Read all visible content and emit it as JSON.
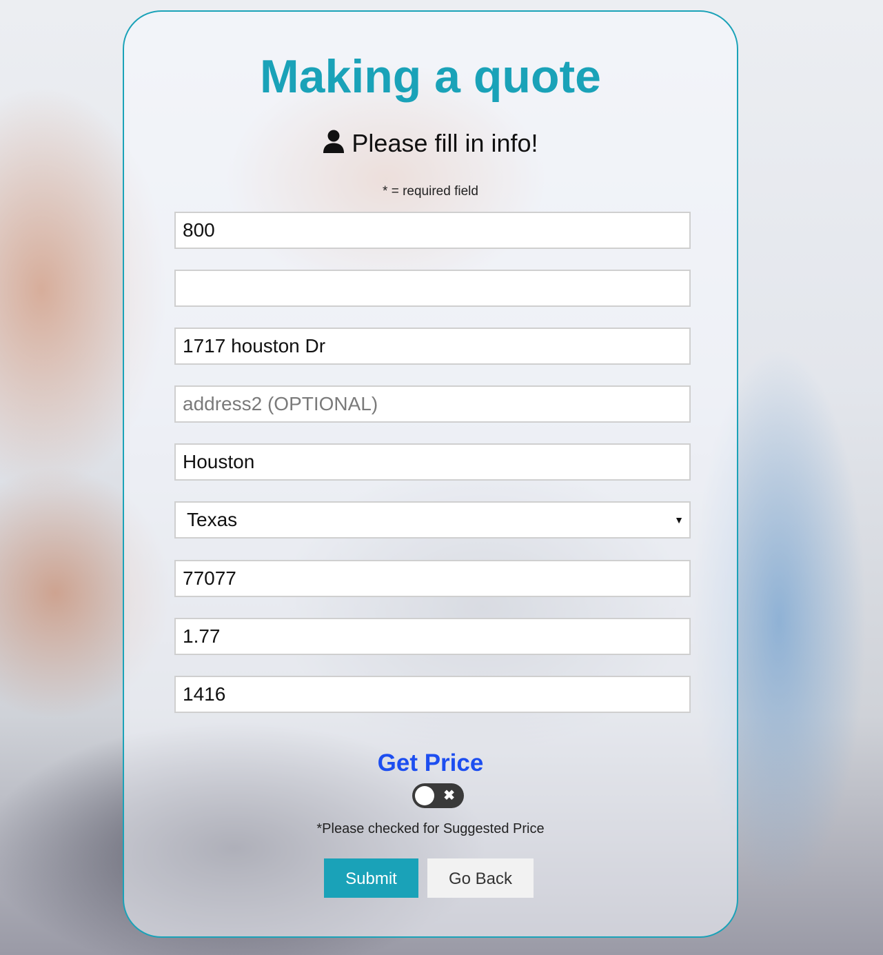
{
  "page": {
    "title": "Making a quote",
    "subtitle": "Please fill in info!",
    "required_note": "* = required field"
  },
  "form": {
    "gallons": {
      "value": "800",
      "placeholder": ""
    },
    "company": {
      "value": "",
      "placeholder": ""
    },
    "address1": {
      "value": "1717 houston Dr",
      "placeholder": ""
    },
    "address2": {
      "value": "",
      "placeholder": "address2 (OPTIONAL)"
    },
    "city": {
      "value": "Houston",
      "placeholder": ""
    },
    "state": {
      "selected": "Texas"
    },
    "zip": {
      "value": "77077",
      "placeholder": ""
    },
    "suggested_price": {
      "value": "1.77",
      "placeholder": ""
    },
    "total": {
      "value": "1416",
      "placeholder": ""
    }
  },
  "actions": {
    "get_price": "Get Price",
    "toggle_checked": false,
    "suggest_note": "*Please checked for Suggested Price",
    "submit": "Submit",
    "go_back": "Go Back"
  },
  "colors": {
    "accent": "#1aa2b8",
    "link": "#1d4ef0"
  },
  "icons": {
    "subtitle_icon": "user-icon",
    "select_arrow": "dropdown-arrow-icon",
    "toggle_off": "close-icon"
  }
}
